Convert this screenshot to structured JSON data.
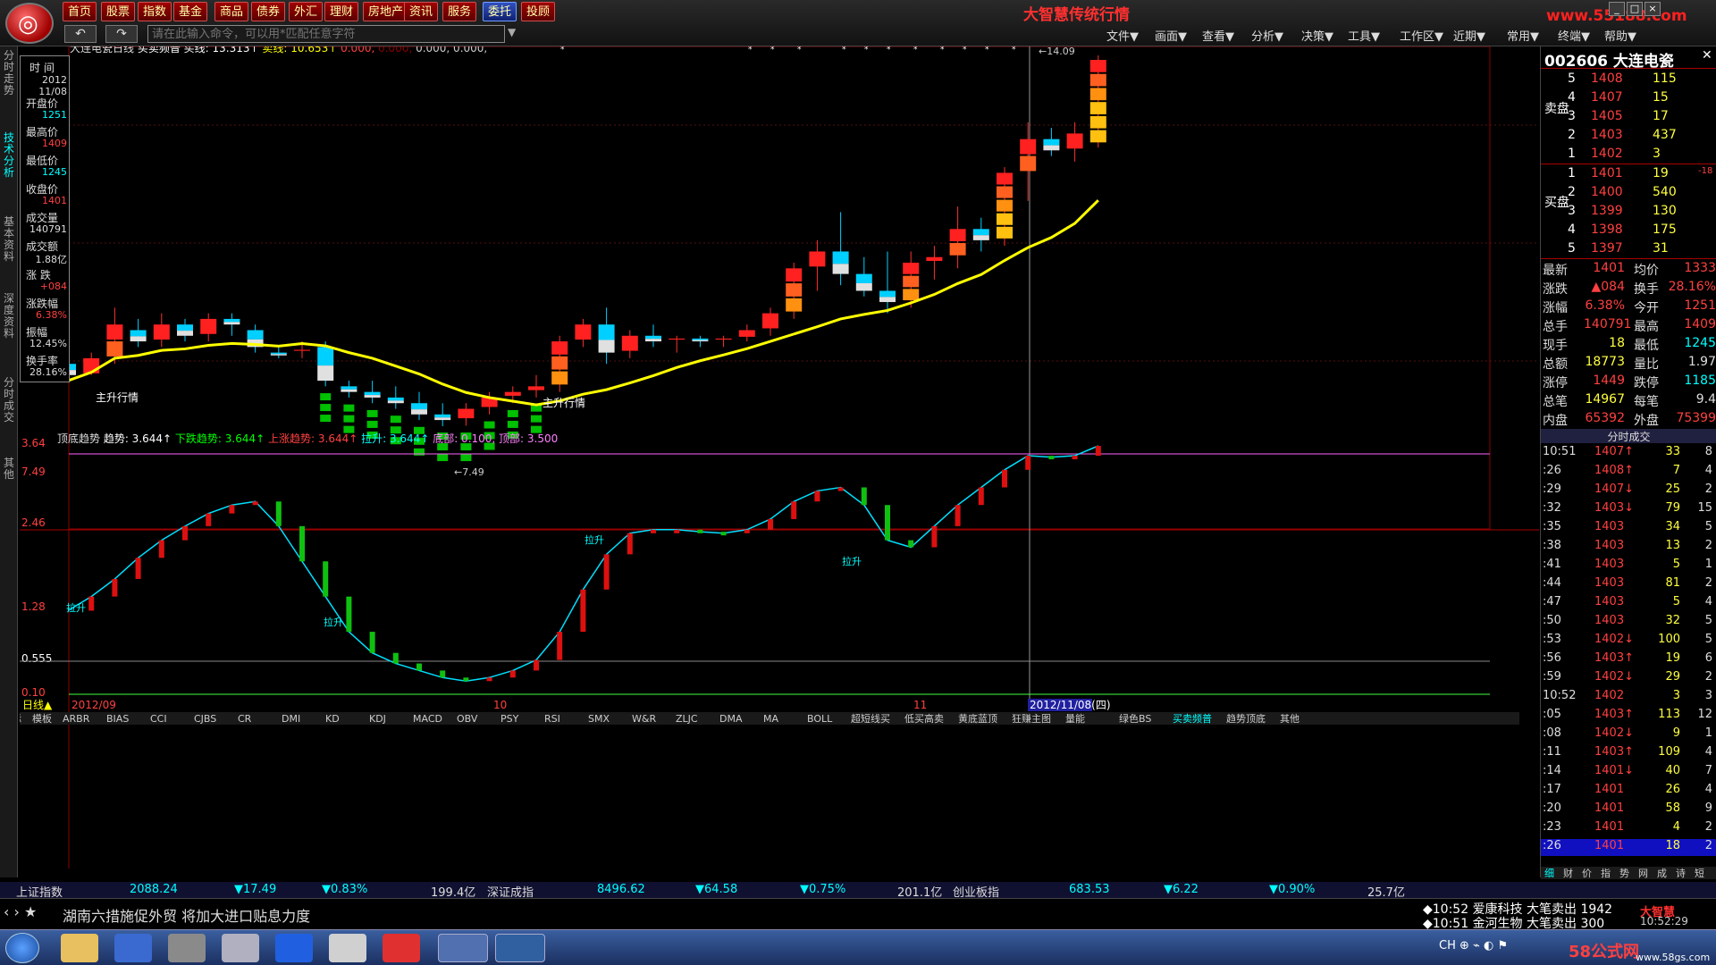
{
  "app": {
    "title": "大智慧传统行情",
    "watermark": "www.55188.com"
  },
  "menu": [
    {
      "label": "首页"
    },
    {
      "label": "股票"
    },
    {
      "label": "指数"
    },
    {
      "label": "基金"
    },
    {
      "label": "商品"
    },
    {
      "label": "债券"
    },
    {
      "label": "外汇"
    },
    {
      "label": "理财"
    },
    {
      "label": "房地产"
    },
    {
      "label": "资讯"
    },
    {
      "label": "服务"
    },
    {
      "label": "委托"
    },
    {
      "label": "投顾"
    }
  ],
  "command": {
    "placeholder": "请在此输入命令，可以用*匹配任意字符"
  },
  "topmenu": [
    "文件▼",
    "画面▼",
    "查看▼",
    "分析▼",
    "决策▼",
    "工具▼",
    "工作区▼",
    "近期▼",
    "常用▼",
    "终端▼",
    "帮助▼"
  ],
  "leftnav": [
    "分时走势",
    "技术分析",
    "基本资料",
    "深度资料",
    "分时成交",
    "其他"
  ],
  "info": {
    "time_lbl": "时 间",
    "date_y": "2012",
    "date_md": "11/08",
    "rows": [
      {
        "label": "开盘价",
        "value": "1251",
        "cls": "c"
      },
      {
        "label": "最高价",
        "value": "1409",
        "cls": "r"
      },
      {
        "label": "最低价",
        "value": "1245",
        "cls": "c"
      },
      {
        "label": "收盘价",
        "value": "1401",
        "cls": "r"
      },
      {
        "label": "成交量",
        "value": "140791",
        "cls": ""
      },
      {
        "label": "成交额",
        "value": "1.88亿",
        "cls": ""
      },
      {
        "label": "涨 跌",
        "value": "+084",
        "cls": "r"
      },
      {
        "label": "涨跌幅",
        "value": "6.38%",
        "cls": "r"
      },
      {
        "label": "振幅",
        "value": "12.45%",
        "cls": ""
      },
      {
        "label": "换手率",
        "value": "28.16%",
        "cls": ""
      }
    ]
  },
  "main_header": {
    "name": "大连电瓷",
    "period": "日线",
    "indicator": "买卖频普",
    "buy_label": "买线:",
    "buy_val": "13.313↑",
    "sell_label": "卖线:",
    "sell_val": "10.653↑",
    "extra_red": "0.000,",
    "extra_dim": "0.000,",
    "extra_gray": "0.000, 0.000,"
  },
  "main_axis": {
    "top": "14.09",
    "bottom": "7.49",
    "high_label": "14.09",
    "low_label": "7.49"
  },
  "main_labels": [
    "主升行情",
    "主升行情"
  ],
  "sub_header": {
    "name": "顶底趋势",
    "trend": "趋势: 3.644↑",
    "down": "下跌趋势: 3.644↑",
    "up": "上涨趋势: 3.644↑",
    "pull": "拉升: 3.644↑",
    "bottom": "底部: 0.100,",
    "top": "顶部: 3.500"
  },
  "sub_axis": [
    "3.64",
    "2.46",
    "1.28",
    "0.555",
    "0.10"
  ],
  "sub_labels": [
    "拉升",
    "拉升",
    "拉升",
    "拉升"
  ],
  "dates": {
    "d1": "2012/09",
    "d2": "10",
    "d3": "11",
    "d4": "2012/11/08(四)"
  },
  "period_tag": "日线",
  "indicator_tabs": [
    "指标",
    "模板",
    "ARBR",
    "BIAS",
    "CCI",
    "CJBS",
    "CR",
    "DMI",
    "KD",
    "KDJ",
    "MACD",
    "OBV",
    "PSY",
    "RSI",
    "SMX",
    "W&R",
    "ZLJC",
    "DMA",
    "MA",
    "BOLL",
    "超短线买",
    "低买高卖",
    "黄底蓝顶",
    "狂赚主图",
    "量能",
    "绿色BS",
    "买卖频普",
    "趋势顶底",
    "其他"
  ],
  "right": {
    "code": "002606",
    "name": "大连电瓷",
    "sell": [
      {
        "n": "5",
        "p": "1408",
        "v": "115"
      },
      {
        "n": "4",
        "p": "1407",
        "v": "15"
      },
      {
        "n": "3",
        "p": "1405",
        "v": "17"
      },
      {
        "n": "2",
        "p": "1403",
        "v": "437"
      },
      {
        "n": "1",
        "p": "1402",
        "v": "3"
      }
    ],
    "buy": [
      {
        "n": "1",
        "p": "1401",
        "v": "19",
        "x": "-18"
      },
      {
        "n": "2",
        "p": "1400",
        "v": "540"
      },
      {
        "n": "3",
        "p": "1399",
        "v": "130"
      },
      {
        "n": "4",
        "p": "1398",
        "v": "175"
      },
      {
        "n": "5",
        "p": "1397",
        "v": "31"
      }
    ],
    "sell_lbl": "卖盘",
    "buy_lbl": "买盘",
    "stats": [
      {
        "l1": "最新",
        "v1": "1401",
        "l2": "均价",
        "v2": "1333"
      },
      {
        "l1": "涨跌",
        "v1": "▲084",
        "l2": "换手",
        "v2": "28.16%"
      },
      {
        "l1": "涨幅",
        "v1": "6.38%",
        "l2": "今开",
        "v2": "1251"
      },
      {
        "l1": "总手",
        "v1": "140791",
        "l2": "最高",
        "v2": "1409"
      },
      {
        "l1": "现手",
        "v1": "18",
        "l2": "最低",
        "v2": "1245"
      },
      {
        "l1": "总额",
        "v1": "18773",
        "l2": "量比",
        "v2": "1.97"
      },
      {
        "l1": "涨停",
        "v1": "1449",
        "l2": "跌停",
        "v2": "1185"
      },
      {
        "l1": "总笔",
        "v1": "14967",
        "l2": "每笔",
        "v2": "9.4"
      },
      {
        "l1": "内盘",
        "v1": "65392",
        "l2": "外盘",
        "v2": "75399"
      }
    ],
    "trades_title": "分时成交",
    "trades": [
      {
        "t": "10:51",
        "p": "1407↑",
        "v": "33",
        "n": "8"
      },
      {
        "t": ":26",
        "p": "1408↑",
        "v": "7",
        "n": "4"
      },
      {
        "t": ":29",
        "p": "1407↓",
        "v": "25",
        "n": "2"
      },
      {
        "t": ":32",
        "p": "1403↓",
        "v": "79",
        "n": "15"
      },
      {
        "t": ":35",
        "p": "1403",
        "v": "34",
        "n": "5"
      },
      {
        "t": ":38",
        "p": "1403",
        "v": "13",
        "n": "2"
      },
      {
        "t": ":41",
        "p": "1403",
        "v": "5",
        "n": "1"
      },
      {
        "t": ":44",
        "p": "1403",
        "v": "81",
        "n": "2"
      },
      {
        "t": ":47",
        "p": "1403",
        "v": "5",
        "n": "4"
      },
      {
        "t": ":50",
        "p": "1403",
        "v": "32",
        "n": "5"
      },
      {
        "t": ":53",
        "p": "1402↓",
        "v": "100",
        "n": "5"
      },
      {
        "t": ":56",
        "p": "1403↑",
        "v": "19",
        "n": "6"
      },
      {
        "t": ":59",
        "p": "1402↓",
        "v": "29",
        "n": "2"
      },
      {
        "t": "10:52",
        "p": "1402",
        "v": "3",
        "n": "3"
      },
      {
        "t": ":05",
        "p": "1403↑",
        "v": "113",
        "n": "12"
      },
      {
        "t": ":08",
        "p": "1402↓",
        "v": "9",
        "n": "1"
      },
      {
        "t": ":11",
        "p": "1403↑",
        "v": "109",
        "n": "4"
      },
      {
        "t": ":14",
        "p": "1401↓",
        "v": "40",
        "n": "7"
      },
      {
        "t": ":17",
        "p": "1401",
        "v": "26",
        "n": "4"
      },
      {
        "t": ":20",
        "p": "1401",
        "v": "58",
        "n": "9"
      },
      {
        "t": ":23",
        "p": "1401",
        "v": "4",
        "n": "2"
      },
      {
        "t": ":26",
        "p": "1401",
        "v": "18",
        "n": "2"
      }
    ],
    "bottom_tabs": [
      "细",
      "财",
      "价",
      "指",
      "势",
      "网",
      "成",
      "诗",
      "短"
    ]
  },
  "ticker": [
    {
      "text": "上证指数",
      "c": "#ddd"
    },
    {
      "text": "2088.24",
      "c": "#00ffff"
    },
    {
      "text": "▼17.49",
      "c": "#00ffff"
    },
    {
      "text": "▼0.83%",
      "c": "#00ffff"
    },
    {
      "text": "199.4亿",
      "c": "#ddd"
    },
    {
      "text": "深证成指",
      "c": "#ddd"
    },
    {
      "text": "8496.62",
      "c": "#00ffff"
    },
    {
      "text": "▼64.58",
      "c": "#00ffff"
    },
    {
      "text": "▼0.75%",
      "c": "#00ffff"
    },
    {
      "text": "201.1亿",
      "c": "#ddd"
    },
    {
      "text": "创业板指",
      "c": "#ddd"
    },
    {
      "text": "683.53",
      "c": "#00ffff"
    },
    {
      "text": "▼6.22",
      "c": "#00ffff"
    },
    {
      "text": "▼0.90%",
      "c": "#00ffff"
    },
    {
      "text": "25.7亿",
      "c": "#ddd"
    }
  ],
  "news": {
    "headline": "湖南六措施促外贸 将加大进口贴息力度",
    "alerts": [
      {
        "time": "10:52",
        "text": "爱康科技 大笔卖出 1942"
      },
      {
        "time": "10:51",
        "text": "金河生物 大笔卖出 300"
      }
    ],
    "clock": "10:52:29",
    "brand": "58公式网",
    "brand_url": "www.58gs.com"
  },
  "colors": {
    "up": "#ff2020",
    "down": "#00d000",
    "ma": "#ffff00",
    "cyan": "#00e0ff"
  }
}
